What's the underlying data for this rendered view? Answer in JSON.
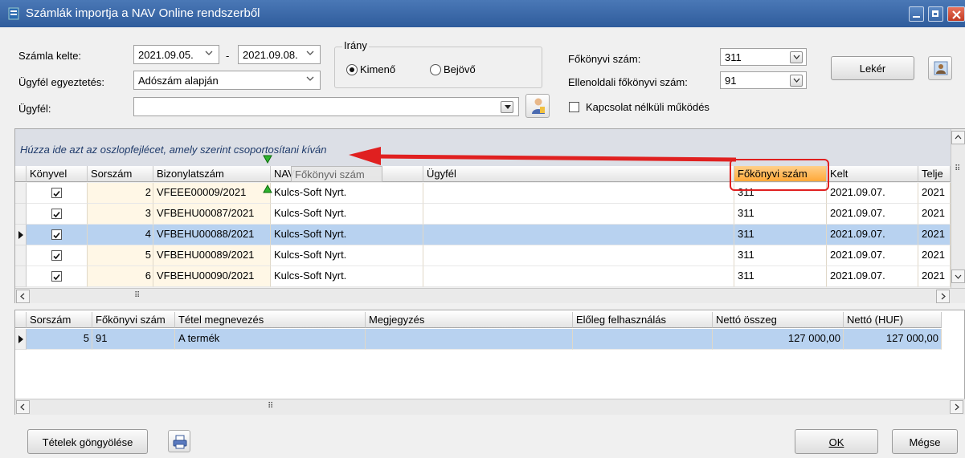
{
  "window": {
    "title": "Számlák importja a NAV Online rendszerből"
  },
  "filters": {
    "date_label": "Számla kelte:",
    "date_from": "2021.09.05.",
    "date_sep": "-",
    "date_to": "2021.09.08.",
    "match_label": "Ügyfél egyeztetés:",
    "match_value": "Adószám alapján",
    "customer_label": "Ügyfél:",
    "customer_value": "",
    "direction_label": "Irány",
    "direction_out": "Kimenő",
    "direction_in": "Bejövő",
    "direction_selected": "Kimenő",
    "gl_label": "Főkönyvi szám:",
    "gl_value": "311",
    "counter_gl_label": "Ellenoldali főkönyvi szám:",
    "counter_gl_value": "91",
    "offline_label": "Kapcsolat nélküli működés",
    "fetch_button": "Lekér"
  },
  "upper_grid": {
    "group_hint": "Húzza ide azt az oszlopfejlécet, amely szerint csoportosítani kíván",
    "drag_ghost": "Főkönyvi szám",
    "columns": [
      "Könyvel",
      "Sorszám",
      "Bizonylatszám",
      "NAV",
      "Ügyfél",
      "Főkönyvi szám",
      "Kelt",
      "Telje"
    ],
    "rows": [
      {
        "checked": true,
        "sorszam": "2",
        "bizonylat": "VFEEE00009/2021",
        "nav": "Kulcs-Soft Nyrt.",
        "ugyfel": "",
        "fokonyv": "311",
        "kelt": "2021.09.07.",
        "telj": "2021"
      },
      {
        "checked": true,
        "sorszam": "3",
        "bizonylat": "VFBEHU00087/2021",
        "nav": "Kulcs-Soft Nyrt.",
        "ugyfel": "",
        "fokonyv": "311",
        "kelt": "2021.09.07.",
        "telj": "2021"
      },
      {
        "checked": true,
        "sorszam": "4",
        "bizonylat": "VFBEHU00088/2021",
        "nav": "Kulcs-Soft Nyrt.",
        "ugyfel": "",
        "fokonyv": "311",
        "kelt": "2021.09.07.",
        "telj": "2021",
        "selected": true
      },
      {
        "checked": true,
        "sorszam": "5",
        "bizonylat": "VFBEHU00089/2021",
        "nav": "Kulcs-Soft Nyrt.",
        "ugyfel": "",
        "fokonyv": "311",
        "kelt": "2021.09.07.",
        "telj": "2021"
      },
      {
        "checked": true,
        "sorszam": "6",
        "bizonylat": "VFBEHU00090/2021",
        "nav": "Kulcs-Soft Nyrt.",
        "ugyfel": "",
        "fokonyv": "311",
        "kelt": "2021.09.07.",
        "telj": "2021"
      }
    ]
  },
  "lower_grid": {
    "columns": [
      "Sorszám",
      "Főkönyvi szám",
      "Tétel megnevezés",
      "Megjegyzés",
      "Előleg felhasználás",
      "Nettó összeg",
      "Nettó (HUF)"
    ],
    "rows": [
      {
        "sorszam": "5",
        "fokonyv": "91",
        "tetel": "A termék",
        "megj": "",
        "eloleg": "",
        "netto": "127 000,00",
        "netto_huf": "127 000,00"
      }
    ]
  },
  "footer": {
    "collapse_button": "Tételek göngyölése",
    "ok_button": "OK",
    "cancel_button": "Mégse"
  },
  "colors": {
    "accent_title": "#3a68a8",
    "highlight_red": "#e02020",
    "selected_row": "#b8d2f0",
    "header_orange": "#ffb24a"
  }
}
